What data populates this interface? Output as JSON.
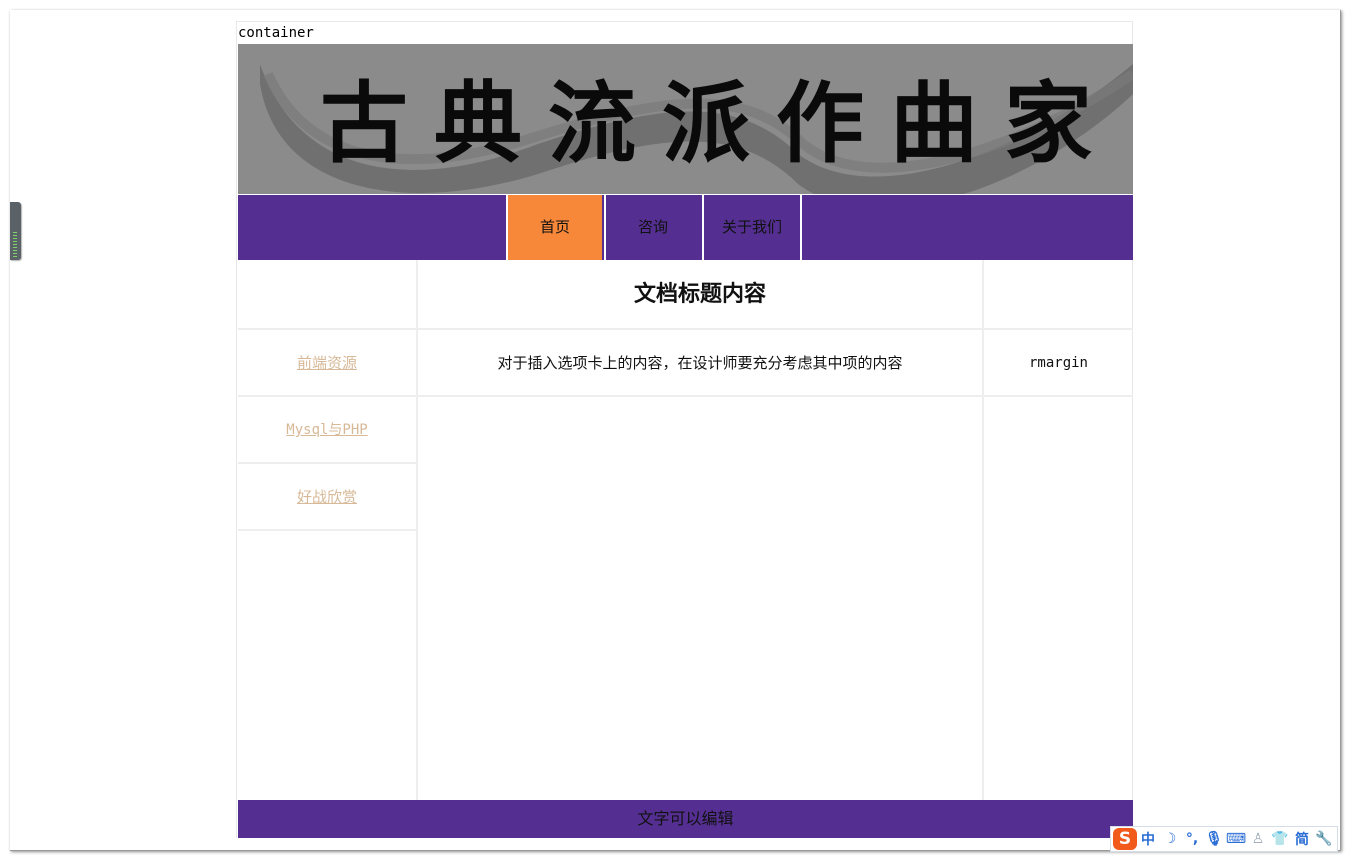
{
  "container_label": "container",
  "banner_text": "古典流派作曲家",
  "nav": {
    "items": [
      {
        "label": "首页",
        "active": true
      },
      {
        "label": "咨询",
        "active": false
      },
      {
        "label": "关于我们",
        "active": false
      }
    ]
  },
  "main": {
    "title": "文档标题内容",
    "content": "对于插入选项卡上的内容，在设计师要充分考虑其中项的内容"
  },
  "sidebar": {
    "links": [
      {
        "label": "前端资源"
      },
      {
        "label": "Mysql与PHP"
      },
      {
        "label": "好战欣赏"
      }
    ]
  },
  "right": {
    "label": "rmargin"
  },
  "footer": {
    "text": "文字可以编辑"
  },
  "ime_toolbar": {
    "logo": "S",
    "mode": "中",
    "variant": "简",
    "icons": [
      "moon-icon",
      "punctuation-icon",
      "microphone-icon",
      "keyboard-icon",
      "user-icon",
      "shirt-icon",
      "wrench-icon"
    ]
  },
  "colors": {
    "nav_bg": "#542f91",
    "nav_active": "#f7883a",
    "banner_bg": "#8b8b8b",
    "link": "#d7b998",
    "ime_logo": "#f25a1b",
    "ime_icons": "#2a6dd4"
  }
}
